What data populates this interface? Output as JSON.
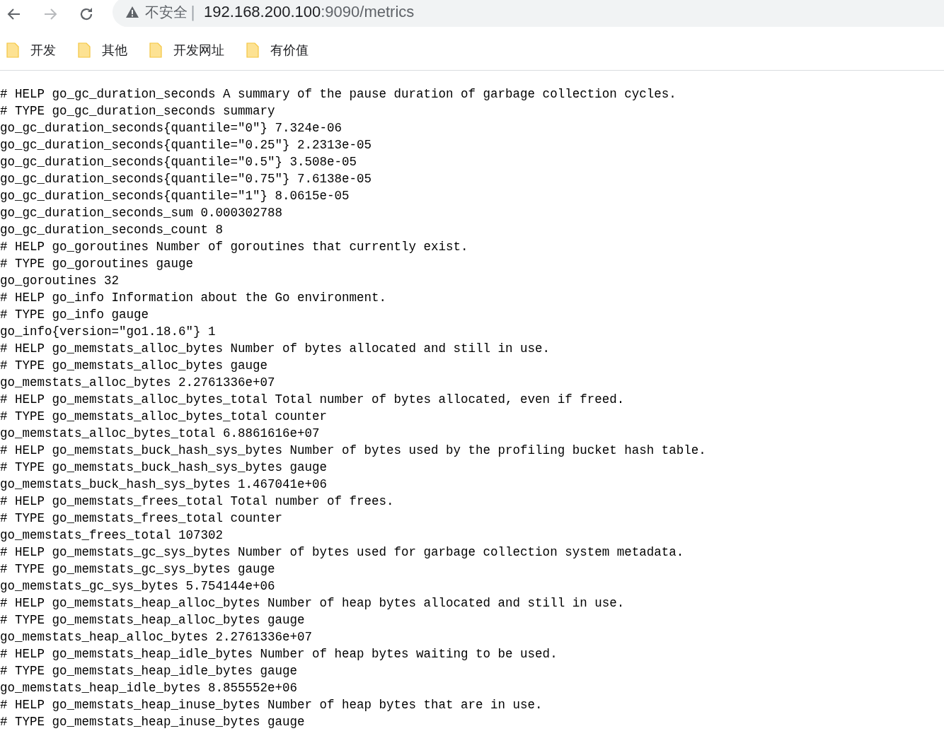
{
  "toolbar": {
    "security_label": "不安全",
    "separator": "|",
    "url_host": "192.168.200.100",
    "url_rest": ":9090/metrics"
  },
  "bookmarks": [
    {
      "label": "开发"
    },
    {
      "label": "其他"
    },
    {
      "label": "开发网址"
    },
    {
      "label": "有价值"
    }
  ],
  "lines": [
    "# HELP go_gc_duration_seconds A summary of the pause duration of garbage collection cycles.",
    "# TYPE go_gc_duration_seconds summary",
    "go_gc_duration_seconds{quantile=\"0\"} 7.324e-06",
    "go_gc_duration_seconds{quantile=\"0.25\"} 2.2313e-05",
    "go_gc_duration_seconds{quantile=\"0.5\"} 3.508e-05",
    "go_gc_duration_seconds{quantile=\"0.75\"} 7.6138e-05",
    "go_gc_duration_seconds{quantile=\"1\"} 8.0615e-05",
    "go_gc_duration_seconds_sum 0.000302788",
    "go_gc_duration_seconds_count 8",
    "# HELP go_goroutines Number of goroutines that currently exist.",
    "# TYPE go_goroutines gauge",
    "go_goroutines 32",
    "# HELP go_info Information about the Go environment.",
    "# TYPE go_info gauge",
    "go_info{version=\"go1.18.6\"} 1",
    "# HELP go_memstats_alloc_bytes Number of bytes allocated and still in use.",
    "# TYPE go_memstats_alloc_bytes gauge",
    "go_memstats_alloc_bytes 2.2761336e+07",
    "# HELP go_memstats_alloc_bytes_total Total number of bytes allocated, even if freed.",
    "# TYPE go_memstats_alloc_bytes_total counter",
    "go_memstats_alloc_bytes_total 6.8861616e+07",
    "# HELP go_memstats_buck_hash_sys_bytes Number of bytes used by the profiling bucket hash table.",
    "# TYPE go_memstats_buck_hash_sys_bytes gauge",
    "go_memstats_buck_hash_sys_bytes 1.467041e+06",
    "# HELP go_memstats_frees_total Total number of frees.",
    "# TYPE go_memstats_frees_total counter",
    "go_memstats_frees_total 107302",
    "# HELP go_memstats_gc_sys_bytes Number of bytes used for garbage collection system metadata.",
    "# TYPE go_memstats_gc_sys_bytes gauge",
    "go_memstats_gc_sys_bytes 5.754144e+06",
    "# HELP go_memstats_heap_alloc_bytes Number of heap bytes allocated and still in use.",
    "# TYPE go_memstats_heap_alloc_bytes gauge",
    "go_memstats_heap_alloc_bytes 2.2761336e+07",
    "# HELP go_memstats_heap_idle_bytes Number of heap bytes waiting to be used.",
    "# TYPE go_memstats_heap_idle_bytes gauge",
    "go_memstats_heap_idle_bytes 8.855552e+06",
    "# HELP go_memstats_heap_inuse_bytes Number of heap bytes that are in use.",
    "# TYPE go_memstats_heap_inuse_bytes gauge"
  ]
}
